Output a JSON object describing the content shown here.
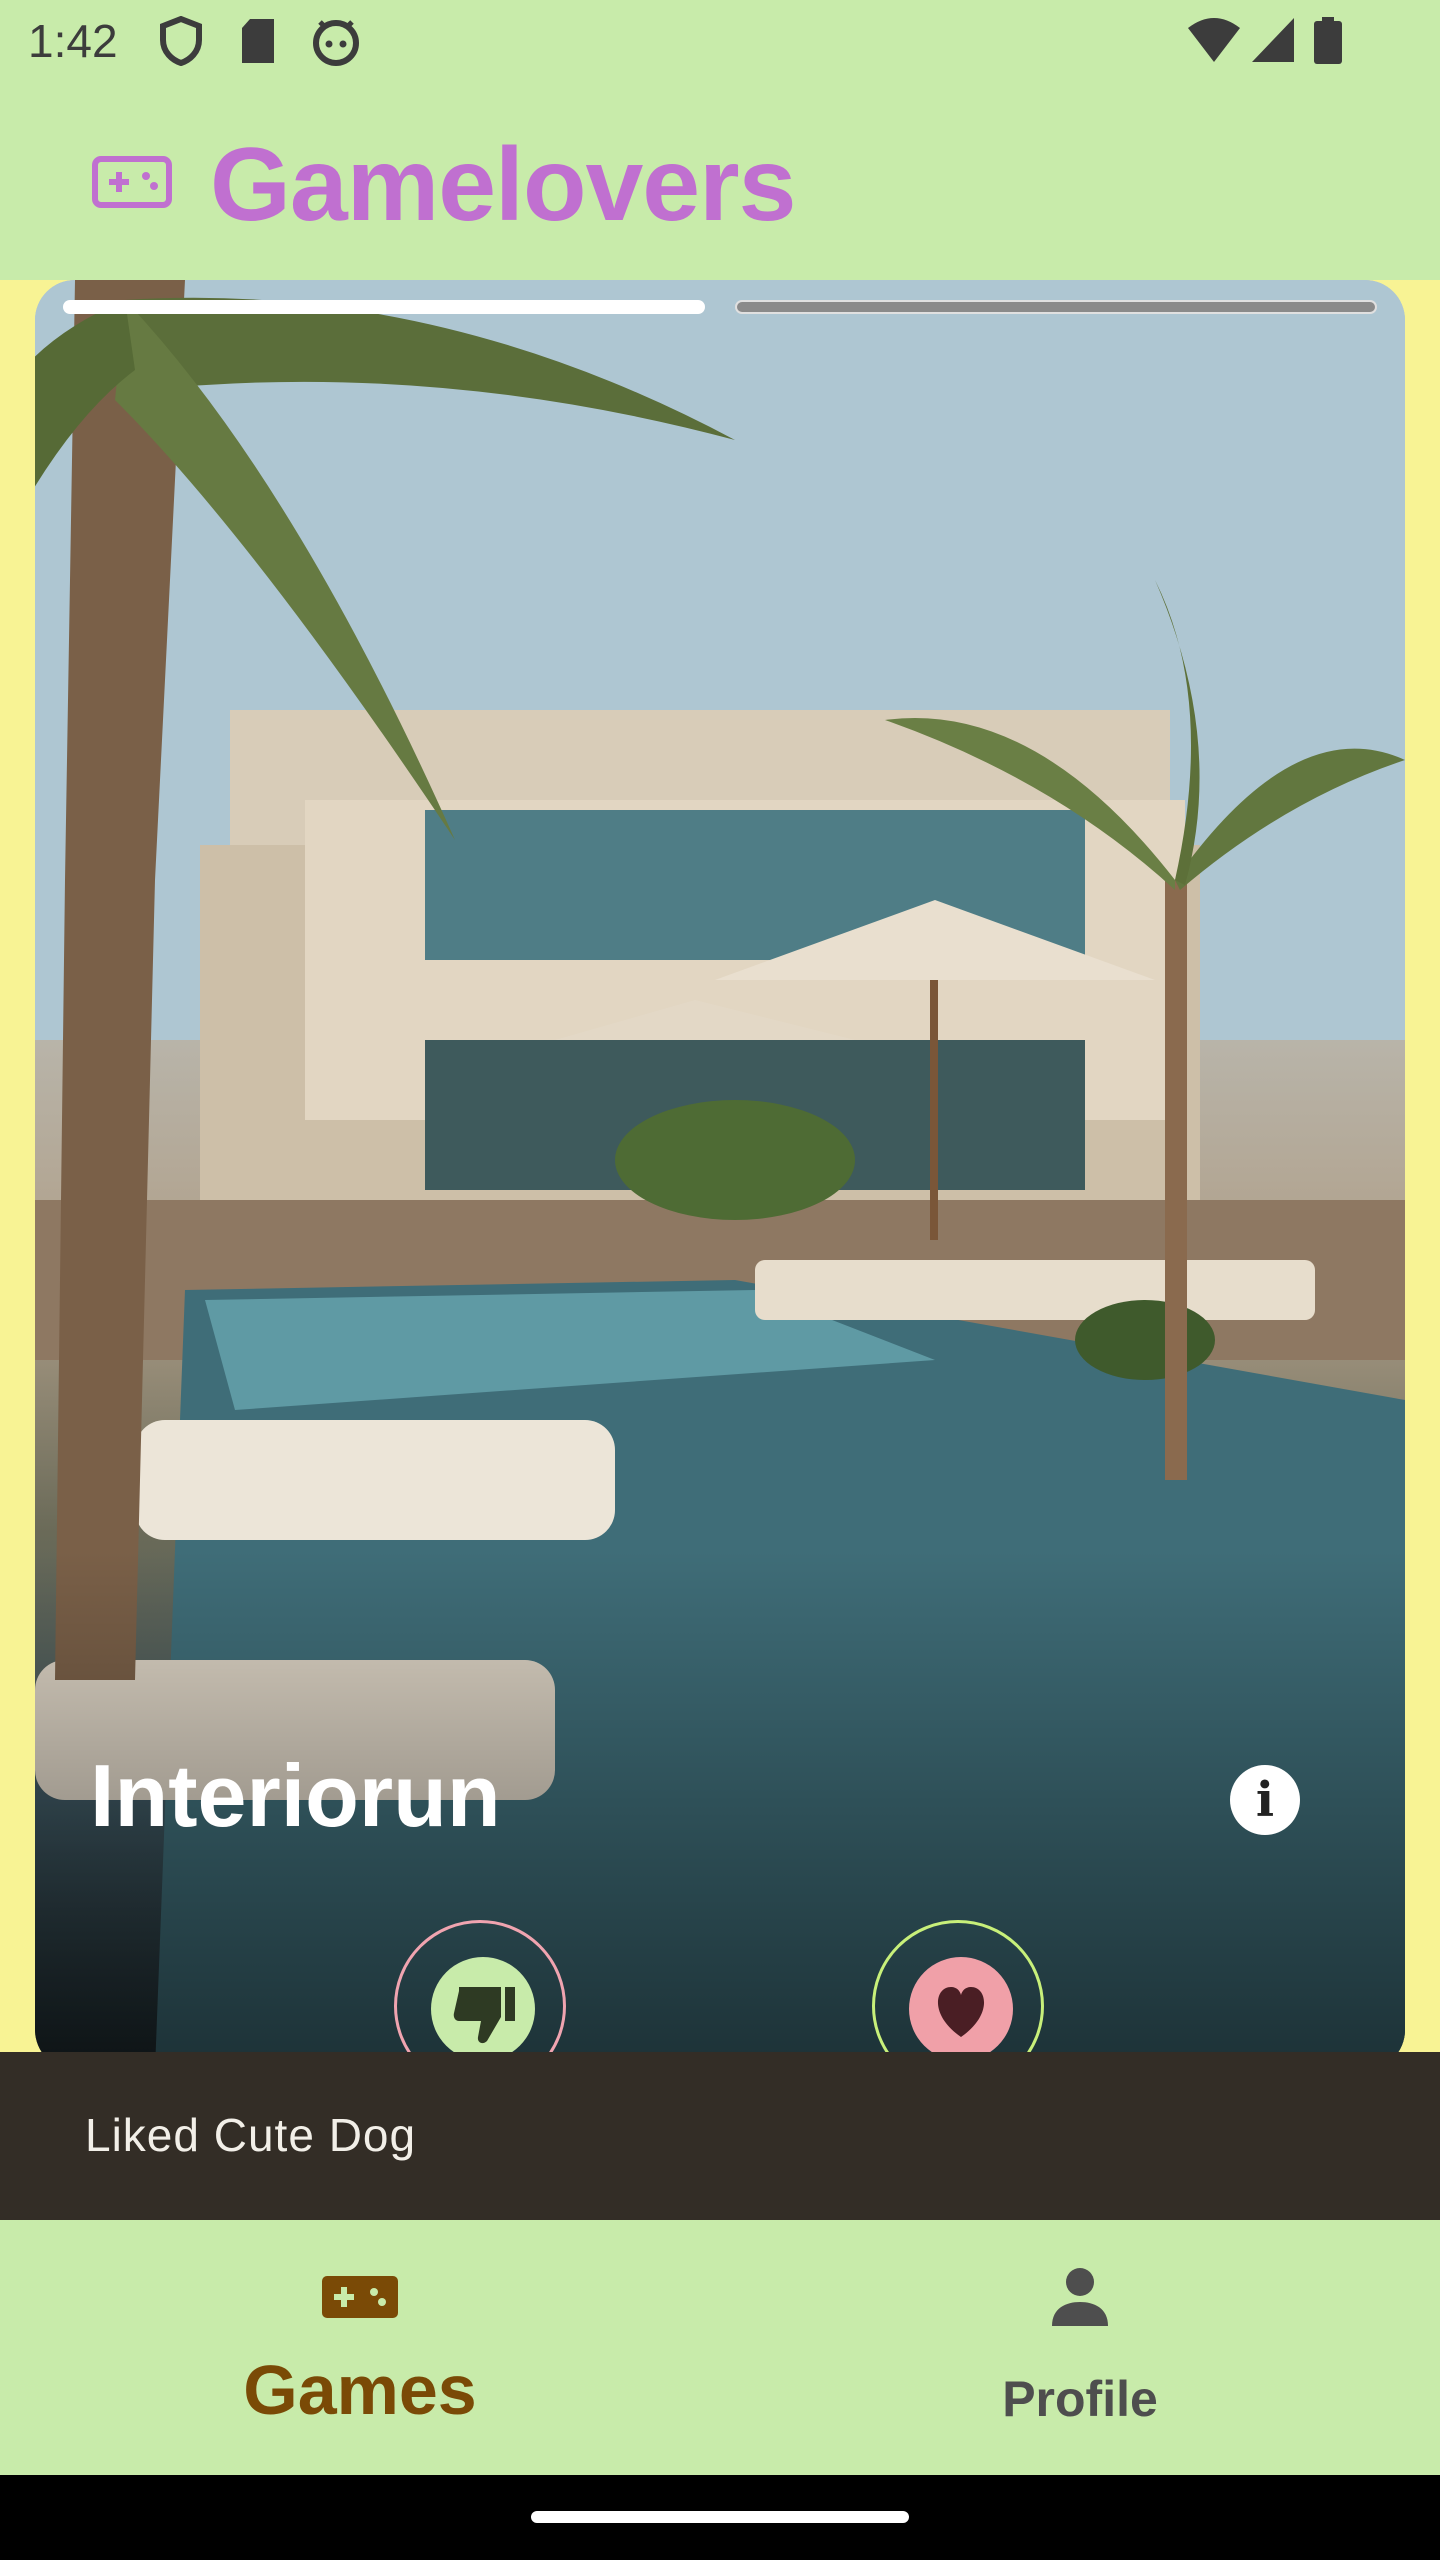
{
  "status_bar": {
    "time": "1:42",
    "icons": [
      "shield-icon",
      "sd-card-icon",
      "android-face-icon",
      "wifi-icon",
      "cell-signal-icon",
      "battery-icon"
    ]
  },
  "header": {
    "logo_icon": "gamepad-icon",
    "title": "Gamelovers",
    "title_color": "#c070d0"
  },
  "card": {
    "title": "Interiorun",
    "image_description_icon": "photo",
    "progress": {
      "segments": 2,
      "active_index": 0
    },
    "info_icon": "info-icon",
    "actions": {
      "dislike_icon": "thumbs-down-icon",
      "like_icon": "heart-icon"
    }
  },
  "snackbar": {
    "message": "Liked Cute Dog"
  },
  "bottom_nav": {
    "items": [
      {
        "label": "Games",
        "icon": "gamepad-icon",
        "selected": true
      },
      {
        "label": "Profile",
        "icon": "person-icon",
        "selected": false
      }
    ]
  },
  "colors": {
    "app_background": "#c8ebaa",
    "content_background": "#f8f394",
    "snackbar": "#332d26",
    "selected_nav": "#7a4a06"
  }
}
